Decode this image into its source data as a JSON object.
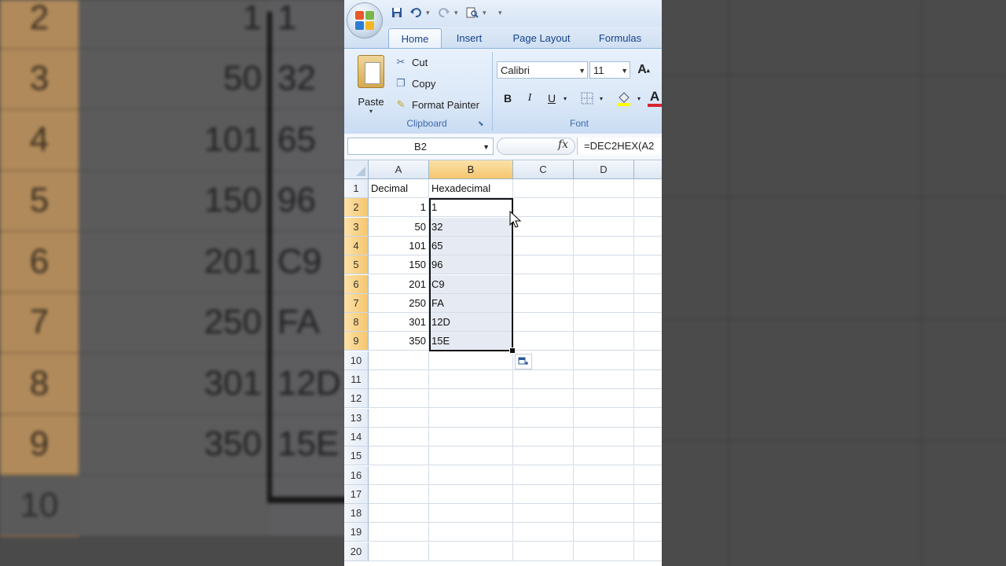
{
  "background": {
    "rows": [
      {
        "row": "2",
        "decimal": "1",
        "hex": "1"
      },
      {
        "row": "3",
        "decimal": "50",
        "hex": "32"
      },
      {
        "row": "4",
        "decimal": "101",
        "hex": "65"
      },
      {
        "row": "5",
        "decimal": "150",
        "hex": "96"
      },
      {
        "row": "6",
        "decimal": "201",
        "hex": "C9"
      },
      {
        "row": "7",
        "decimal": "250",
        "hex": "FA"
      },
      {
        "row": "8",
        "decimal": "301",
        "hex": "12D"
      },
      {
        "row": "9",
        "decimal": "350",
        "hex": "15E"
      },
      {
        "row": "10",
        "decimal": "",
        "hex": ""
      }
    ]
  },
  "tabs": [
    "Home",
    "Insert",
    "Page Layout",
    "Formulas"
  ],
  "clipboard": {
    "paste_label": "Paste",
    "cut_label": "Cut",
    "copy_label": "Copy",
    "format_painter_label": "Format Painter",
    "group_label": "Clipboard"
  },
  "font": {
    "family": "Calibri",
    "size": "11",
    "grow_label": "A",
    "bold_label": "B",
    "italic_label": "I",
    "underline_label": "U",
    "color_label": "A",
    "group_label": "Font"
  },
  "formula_bar": {
    "name_box": "B2",
    "fx_label": "fx",
    "formula": "=DEC2HEX(A2"
  },
  "grid": {
    "columns": [
      "A",
      "B",
      "C",
      "D"
    ],
    "row_numbers": [
      "1",
      "2",
      "3",
      "4",
      "5",
      "6",
      "7",
      "8",
      "9",
      "10",
      "11",
      "12",
      "13",
      "14",
      "15",
      "16",
      "17",
      "18",
      "19",
      "20"
    ],
    "header_row": {
      "a": "Decimal",
      "b": "Hexadecimal"
    },
    "data_rows": [
      {
        "a": "1",
        "b": "1"
      },
      {
        "a": "50",
        "b": "32"
      },
      {
        "a": "101",
        "b": "65"
      },
      {
        "a": "150",
        "b": "96"
      },
      {
        "a": "201",
        "b": "C9"
      },
      {
        "a": "250",
        "b": "FA"
      },
      {
        "a": "301",
        "b": "12D"
      },
      {
        "a": "350",
        "b": "15E"
      }
    ]
  },
  "colors": {
    "selected_header": "#f5c66f",
    "tab_text": "#15428b",
    "ribbon": "#dbe8f7"
  }
}
